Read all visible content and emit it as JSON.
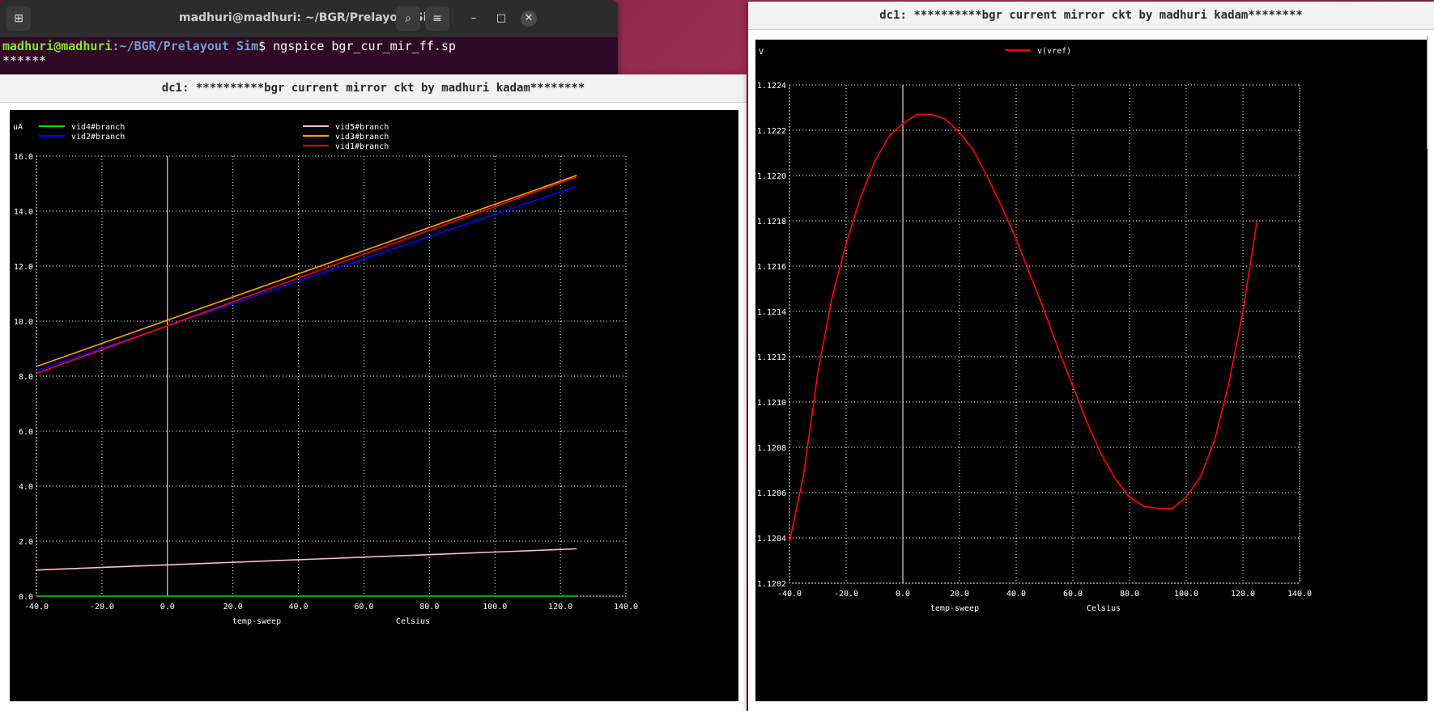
{
  "terminal": {
    "title": "madhuri@madhuri: ~/BGR/Prelayout Sim",
    "user_host": "madhuri@madhuri",
    "path": ":~/BGR/Prelayout Sim",
    "prompt_end": "$",
    "command": " ngspice bgr_cur_mir_ff.sp",
    "line2": "******",
    "icons": [
      "new-tab-icon",
      "search-icon",
      "menu-icon",
      "minimize-icon",
      "maximize-icon",
      "close-icon"
    ]
  },
  "left_window": {
    "title": "dc1: **********bgr current mirror ckt by madhuri kadam********"
  },
  "right_window": {
    "title": "dc1: **********bgr current mirror ckt by madhuri kadam********"
  },
  "colors": {
    "vid4": "#00e000",
    "vid2": "#0000ff",
    "vid5": "#ffc0cb",
    "vid3": "#ffa500",
    "vid1": "#ff0000",
    "vref": "#ff0000",
    "grid": "#ffffff",
    "background": "#000000"
  },
  "chart_data": [
    {
      "type": "line",
      "ylabel": "uA",
      "xlabel": "temp-sweep",
      "xunit": "Celsius",
      "xlim": [
        -40,
        140
      ],
      "ylim": [
        0,
        16
      ],
      "xticks": [
        "-40.0",
        "-20.0",
        "0.0",
        "20.0",
        "40.0",
        "60.0",
        "80.0",
        "100.0",
        "120.0",
        "140.0"
      ],
      "yticks": [
        "0.0",
        "2.0",
        "4.0",
        "6.0",
        "8.0",
        "10.0",
        "12.0",
        "14.0",
        "16.0"
      ],
      "grid": true,
      "legend_position": "top",
      "x": [
        -40,
        125
      ],
      "series": [
        {
          "name": "vid4#branch",
          "values": [
            0.0,
            0.0
          ]
        },
        {
          "name": "vid2#branch",
          "values": [
            8.2,
            14.9
          ]
        },
        {
          "name": "vid5#branch",
          "values": [
            0.95,
            1.72
          ]
        },
        {
          "name": "vid3#branch",
          "values": [
            8.35,
            15.3
          ]
        },
        {
          "name": "vid1#branch",
          "values": [
            8.1,
            15.25
          ]
        }
      ]
    },
    {
      "type": "line",
      "ylabel": "V",
      "xlabel": "temp-sweep",
      "xunit": "Celsius",
      "xlim": [
        -40,
        140
      ],
      "ylim": [
        1.1202,
        1.1224
      ],
      "xticks": [
        "-40.0",
        "-20.0",
        "0.0",
        "20.0",
        "40.0",
        "60.0",
        "80.0",
        "100.0",
        "120.0",
        "140.0"
      ],
      "yticks": [
        "1.1202",
        "1.1204",
        "1.1206",
        "1.1208",
        "1.1210",
        "1.1212",
        "1.1214",
        "1.1216",
        "1.1218",
        "1.1220",
        "1.1222",
        "1.1224"
      ],
      "grid": true,
      "legend_position": "top",
      "x": [
        -40,
        -35,
        -30,
        -25,
        -20,
        -15,
        -10,
        -5,
        0,
        5,
        10,
        15,
        20,
        25,
        30,
        35,
        40,
        45,
        50,
        55,
        60,
        65,
        70,
        75,
        80,
        85,
        90,
        95,
        100,
        105,
        110,
        115,
        120,
        125
      ],
      "series": [
        {
          "name": "v(vref)",
          "values": [
            1.12038,
            1.12068,
            1.12113,
            1.12146,
            1.1217,
            1.1219,
            1.12206,
            1.12217,
            1.12223,
            1.12227,
            1.12227,
            1.12225,
            1.12219,
            1.12211,
            1.12199,
            1.12186,
            1.12172,
            1.12156,
            1.1214,
            1.12123,
            1.12107,
            1.12091,
            1.12077,
            1.12066,
            1.12058,
            1.12054,
            1.12053,
            1.12053,
            1.12058,
            1.12067,
            1.12083,
            1.12108,
            1.1214,
            1.1218
          ]
        }
      ]
    }
  ]
}
